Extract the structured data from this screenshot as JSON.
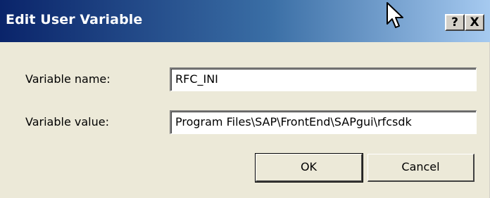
{
  "window": {
    "title": "Edit User Variable",
    "help_button": "?",
    "close_button": "X"
  },
  "form": {
    "name_label": "Variable name:",
    "name_value": "RFC_INI",
    "value_label": "Variable value:",
    "value_value": "Program Files\\SAP\\FrontEnd\\SAPgui\\rfcsdk"
  },
  "buttons": {
    "ok_label": "OK",
    "cancel_label": "Cancel"
  },
  "icons": {
    "cursor": "arrow-cursor-icon"
  },
  "colors": {
    "title_gradient_start": "#0a246a",
    "title_gradient_end": "#a6caf0",
    "dialog_background": "#ece9d8"
  }
}
